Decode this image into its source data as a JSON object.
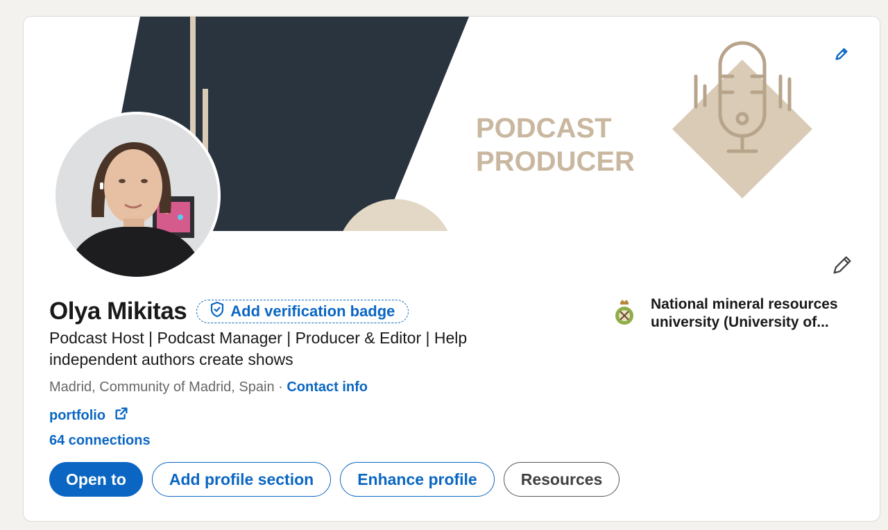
{
  "banner": {
    "line1": "PODCAST",
    "line2": "PRODUCER",
    "colors": {
      "dark": "#2a343f",
      "beige": "#d9cbb6",
      "text": "#c9b79f"
    },
    "edit_icon": "pencil-icon"
  },
  "profile": {
    "name": "Olya Mikitas",
    "verification_badge_label": "Add verification badge",
    "headline": "Podcast Host | Podcast Manager | Producer & Editor | Help independent authors create shows",
    "location": "Madrid, Community of Madrid, Spain",
    "separator": " · ",
    "contact_info": "Contact info",
    "website": "portfolio",
    "connections": "64 connections",
    "edit_icon": "pencil-icon"
  },
  "education": {
    "name": "National mineral resources university (University of..."
  },
  "actions": {
    "open_to": "Open to",
    "add_section": "Add profile section",
    "enhance": "Enhance profile",
    "resources": "Resources"
  },
  "colors": {
    "accent": "#0a66c2",
    "text": "#191919",
    "muted": "#666666"
  }
}
